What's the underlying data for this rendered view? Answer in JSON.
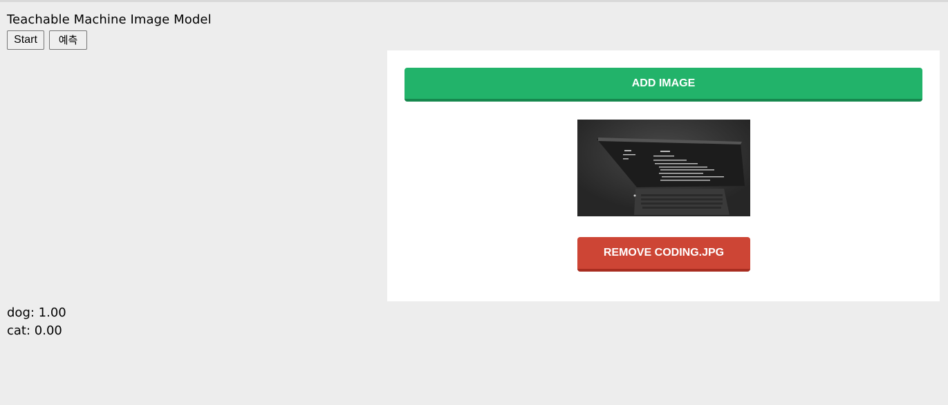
{
  "page": {
    "title": "Teachable Machine Image Model"
  },
  "controls": {
    "start_label": "Start",
    "predict_label": "예측"
  },
  "uploader": {
    "add_label": "ADD IMAGE",
    "remove_label": "REMOVE CODING.JPG",
    "image_description": "dark photo of a laptop with code on screen",
    "colors": {
      "add_button": "#22b36a",
      "remove_button": "#cd4535"
    }
  },
  "predictions": [
    {
      "label": "dog: 1.00"
    },
    {
      "label": "cat: 0.00"
    }
  ]
}
